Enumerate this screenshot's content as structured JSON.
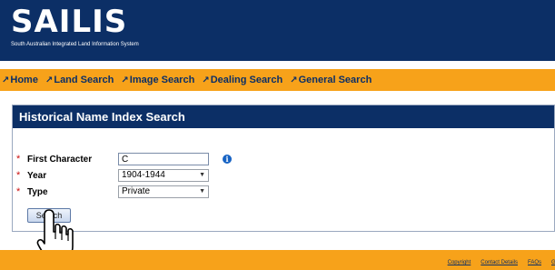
{
  "header": {
    "logo_text": "SAILIS",
    "subtitle": "South Australian Integrated Land Information System"
  },
  "nav": {
    "items": [
      {
        "label": "Home"
      },
      {
        "label": "Land Search"
      },
      {
        "label": "Image Search"
      },
      {
        "label": "Dealing Search"
      },
      {
        "label": "General Search"
      }
    ],
    "arrow_icon": "external-link-arrow-icon"
  },
  "panel": {
    "title": "Historical Name Index Search"
  },
  "form": {
    "required_marker": "*",
    "first_character": {
      "label": "First Character",
      "value": "C",
      "info_icon": "info-icon"
    },
    "year": {
      "label": "Year",
      "value": "1904-1944"
    },
    "type": {
      "label": "Type",
      "value": "Private"
    },
    "search_label": "Search"
  },
  "footer": {
    "links": [
      "Copyright",
      "Contact Details",
      "FAQs",
      "Gl"
    ]
  },
  "colors": {
    "header_bg": "#0c2f66",
    "accent": "#f7a21a",
    "required": "#cc1111",
    "info": "#1763c4"
  }
}
